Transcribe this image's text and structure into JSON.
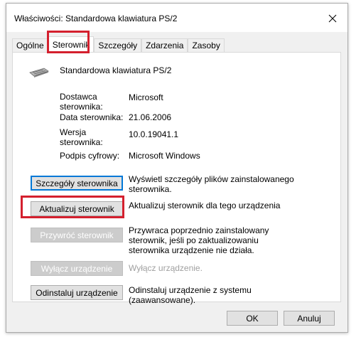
{
  "window": {
    "title": "Właściwości: Standardowa klawiatura PS/2",
    "close_glyph": "✕"
  },
  "tabs": [
    {
      "label": "Ogólne"
    },
    {
      "label": "Sterownik"
    },
    {
      "label": "Szczegóły"
    },
    {
      "label": "Zdarzenia"
    },
    {
      "label": "Zasoby"
    }
  ],
  "active_tab": "Sterownik",
  "device": {
    "icon": "keyboard-icon",
    "name": "Standardowa klawiatura PS/2"
  },
  "properties": {
    "provider_label": "Dostawca\nsterownika:",
    "provider_value": "Microsoft",
    "date_label": "Data sterownika:",
    "date_value": "21.06.2006",
    "version_label": "Wersja\nsterownika:",
    "version_value": "10.0.19041.1",
    "signer_label": "Podpis cyfrowy:",
    "signer_value": "Microsoft Windows"
  },
  "actions": {
    "details_button": "Szczegóły sterownika",
    "details_desc": "Wyświetl szczegóły plików zainstalowanego sterownika.",
    "update_button": "Aktualizuj sterownik",
    "update_desc": "Aktualizuj sterownik dla tego urządzenia",
    "rollback_button": "Przywróć sterownik",
    "rollback_desc": "Przywraca poprzednio zainstalowany sterownik, jeśli po zaktualizowaniu sterownika urządzenie nie działa.",
    "disable_button": "Wyłącz urządzenie",
    "disable_desc": "Wyłącz urządzenie.",
    "uninstall_button": "Odinstaluj urządzenie",
    "uninstall_desc": "Odinstaluj urządzenie z systemu (zaawansowane)."
  },
  "footer": {
    "ok_label": "OK",
    "cancel_label": "Anuluj"
  },
  "colors": {
    "highlight": "#d4202e",
    "focus": "#0078d7"
  }
}
